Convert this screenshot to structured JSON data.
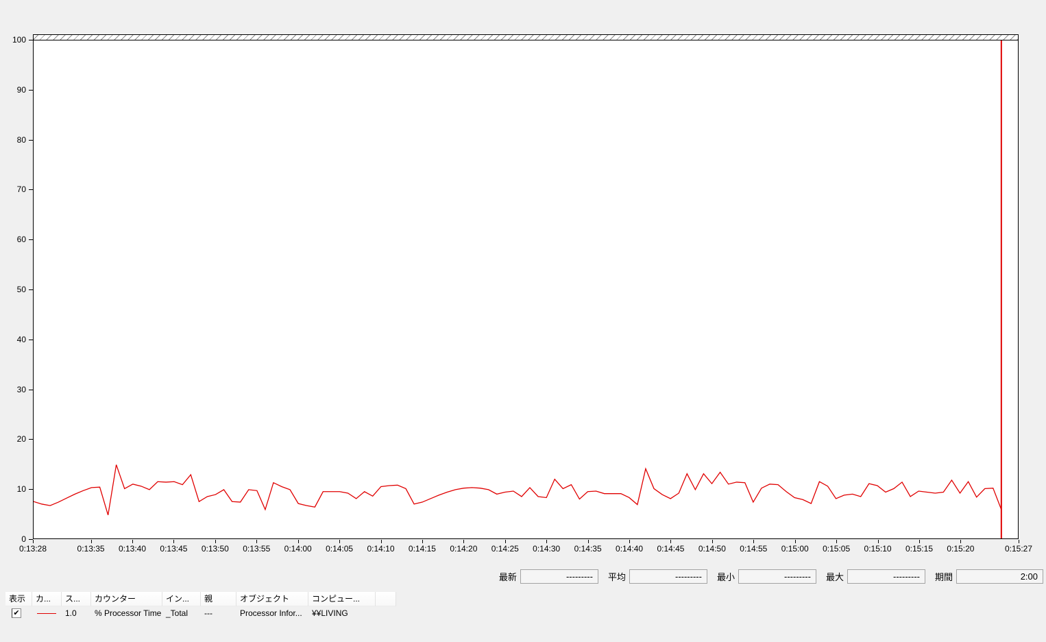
{
  "chart_data": {
    "type": "line",
    "title": "",
    "xlabel": "",
    "ylabel": "",
    "ylim": [
      0,
      100
    ],
    "grid": false,
    "legend_position": "bottom-table",
    "y_ticks": [
      0,
      10,
      20,
      30,
      40,
      50,
      60,
      70,
      80,
      90,
      100
    ],
    "x_time_span_seconds": 119,
    "x_ticks": [
      {
        "s": 0,
        "label": "0:13:28"
      },
      {
        "s": 7,
        "label": "0:13:35"
      },
      {
        "s": 12,
        "label": "0:13:40"
      },
      {
        "s": 17,
        "label": "0:13:45"
      },
      {
        "s": 22,
        "label": "0:13:50"
      },
      {
        "s": 27,
        "label": "0:13:55"
      },
      {
        "s": 32,
        "label": "0:14:00"
      },
      {
        "s": 37,
        "label": "0:14:05"
      },
      {
        "s": 42,
        "label": "0:14:10"
      },
      {
        "s": 47,
        "label": "0:14:15"
      },
      {
        "s": 52,
        "label": "0:14:20"
      },
      {
        "s": 57,
        "label": "0:14:25"
      },
      {
        "s": 62,
        "label": "0:14:30"
      },
      {
        "s": 67,
        "label": "0:14:35"
      },
      {
        "s": 72,
        "label": "0:14:40"
      },
      {
        "s": 77,
        "label": "0:14:45"
      },
      {
        "s": 82,
        "label": "0:14:50"
      },
      {
        "s": 87,
        "label": "0:14:55"
      },
      {
        "s": 92,
        "label": "0:15:00"
      },
      {
        "s": 97,
        "label": "0:15:05"
      },
      {
        "s": 102,
        "label": "0:15:10"
      },
      {
        "s": 107,
        "label": "0:15:15"
      },
      {
        "s": 112,
        "label": "0:15:20"
      },
      {
        "s": 119,
        "label": "0:15:27"
      }
    ],
    "cursor_time_seconds": 117,
    "series": [
      {
        "name": "% Processor Time",
        "color": "#e00000",
        "start_offset_seconds": 0,
        "interval_seconds": 1,
        "values": [
          7.4,
          6.9,
          6.6,
          7.3,
          8.1,
          8.9,
          9.6,
          10.2,
          10.3,
          4.7,
          14.8,
          10.0,
          10.9,
          10.5,
          9.8,
          11.4,
          11.3,
          11.4,
          10.8,
          12.8,
          7.4,
          8.4,
          8.8,
          9.8,
          7.4,
          7.3,
          9.8,
          9.6,
          5.8,
          11.2,
          10.4,
          9.8,
          7.0,
          6.6,
          6.3,
          9.4,
          9.4,
          9.4,
          9.1,
          8.0,
          9.4,
          8.5,
          10.4,
          10.6,
          10.7,
          10.0,
          6.9,
          7.3,
          8.0,
          8.7,
          9.3,
          9.8,
          10.1,
          10.2,
          10.1,
          9.8,
          8.9,
          9.3,
          9.5,
          8.4,
          10.2,
          8.4,
          8.2,
          11.9,
          10.0,
          10.8,
          7.9,
          9.4,
          9.5,
          9.0,
          9.0,
          9.0,
          8.2,
          6.8,
          14.0,
          10.0,
          8.8,
          8.0,
          9.1,
          13.0,
          9.8,
          13.0,
          11.0,
          13.3,
          10.9,
          11.3,
          11.2,
          7.3,
          10.1,
          10.9,
          10.8,
          9.4,
          8.2,
          7.8,
          7.0,
          11.4,
          10.5,
          8.0,
          8.7,
          8.9,
          8.4,
          11.0,
          10.6,
          9.3,
          10.0,
          11.3,
          8.4,
          9.5,
          9.3,
          9.1,
          9.3,
          11.7,
          9.1,
          11.4,
          8.3,
          10.0,
          10.1,
          5.8
        ]
      }
    ]
  },
  "stats": {
    "items": [
      {
        "label": "最新",
        "value": "---------"
      },
      {
        "label": "平均",
        "value": "---------"
      },
      {
        "label": "最小",
        "value": "---------"
      },
      {
        "label": "最大",
        "value": "---------"
      },
      {
        "label": "期間",
        "value": "2:00"
      }
    ]
  },
  "legend_table": {
    "columns": [
      "表示",
      "カ...",
      "ス...",
      "カウンター",
      "イン...",
      "親",
      "オブジェクト",
      "コンピュー...",
      ""
    ],
    "rows": [
      {
        "checked": true,
        "check_glyph": "✔",
        "color": "#e00000",
        "scale": "1.0",
        "counter": "% Processor Time",
        "instance": "_Total",
        "parent": "---",
        "object": "Processor Infor...",
        "computer": "¥¥LIVING"
      }
    ]
  },
  "colors": {
    "background": "#f0f0f0",
    "plot_background": "#ffffff",
    "plot_border": "#000000",
    "line": "#e00000",
    "cursor": "#e00000"
  }
}
